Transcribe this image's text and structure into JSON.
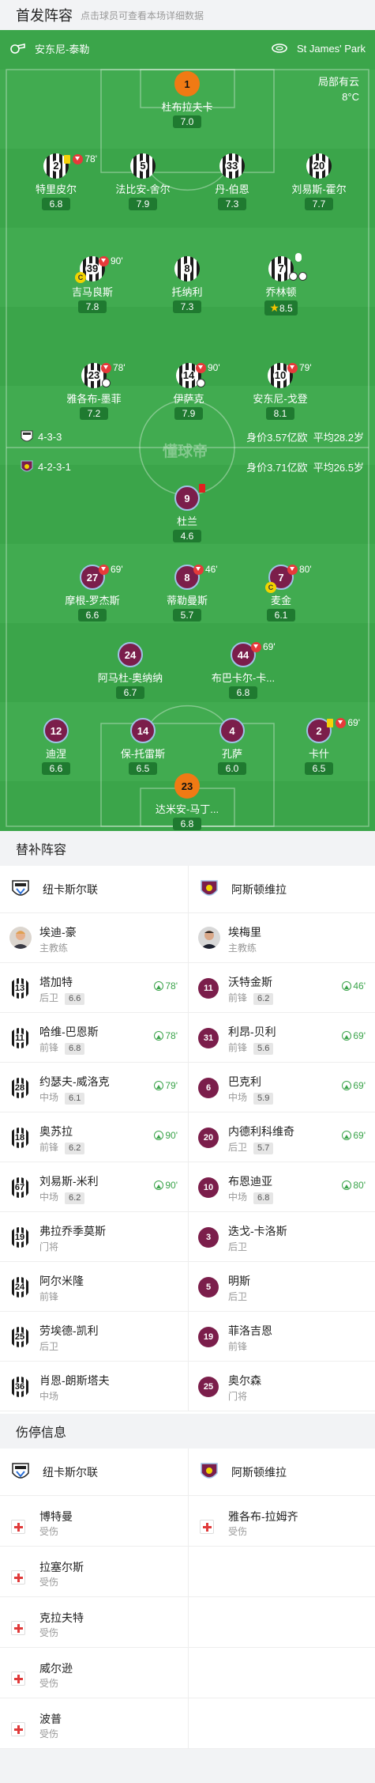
{
  "header": {
    "title": "首发阵容",
    "subtitle": "点击球员可查看本场详细数据"
  },
  "venue": {
    "ref_name": "安东尼-泰勒",
    "stadium": "St James' Park"
  },
  "weather": {
    "condition": "局部有云",
    "temp": "8°C"
  },
  "home": {
    "formation": "4-3-3",
    "value": "身价3.57亿欧",
    "age": "平均28.2岁",
    "gk": {
      "num": "1",
      "name": "杜布拉夫卡",
      "rating": "7.0"
    },
    "def": [
      {
        "num": "2",
        "name": "特里皮尔",
        "rating": "6.8",
        "sub": "78'"
      },
      {
        "num": "5",
        "name": "法比安-舍尔",
        "rating": "7.9"
      },
      {
        "num": "33",
        "name": "丹-伯恩",
        "rating": "7.3"
      },
      {
        "num": "20",
        "name": "刘易斯-霍尔",
        "rating": "7.7"
      }
    ],
    "mid": [
      {
        "num": "39",
        "name": "吉马良斯",
        "rating": "7.8",
        "sub": "90'"
      },
      {
        "num": "8",
        "name": "托纳利",
        "rating": "7.3"
      },
      {
        "num": "7",
        "name": "乔林顿",
        "rating": "8.5"
      }
    ],
    "fwd": [
      {
        "num": "23",
        "name": "雅各布-墨菲",
        "rating": "7.2",
        "sub": "78'"
      },
      {
        "num": "14",
        "name": "伊萨克",
        "rating": "7.9",
        "sub": "90'"
      },
      {
        "num": "10",
        "name": "安东尼-戈登",
        "rating": "8.1",
        "sub": "79'"
      }
    ]
  },
  "away": {
    "formation": "4-2-3-1",
    "value": "身价3.71亿欧",
    "age": "平均26.5岁",
    "st": {
      "num": "9",
      "name": "杜兰",
      "rating": "4.6"
    },
    "am": [
      {
        "num": "27",
        "name": "摩根-罗杰斯",
        "rating": "6.6",
        "sub": "69'"
      },
      {
        "num": "8",
        "name": "蒂勒曼斯",
        "rating": "5.7",
        "sub": "46'"
      },
      {
        "num": "7",
        "name": "麦金",
        "rating": "6.1",
        "sub": "80'"
      }
    ],
    "dm": [
      {
        "num": "24",
        "name": "阿马杜-奥纳纳",
        "rating": "6.7"
      },
      {
        "num": "44",
        "name": "布巴卡尔-卡...",
        "rating": "6.8",
        "sub": "69'"
      }
    ],
    "def": [
      {
        "num": "12",
        "name": "迪涅",
        "rating": "6.6"
      },
      {
        "num": "14",
        "name": "保-托雷斯",
        "rating": "6.5"
      },
      {
        "num": "4",
        "name": "孔萨",
        "rating": "6.0"
      },
      {
        "num": "2",
        "name": "卡什",
        "rating": "6.5",
        "sub": "69'"
      }
    ],
    "gk": {
      "num": "23",
      "name": "达米安-马丁...",
      "rating": "6.8"
    }
  },
  "subs": {
    "title": "替补阵容",
    "home_team": "纽卡斯尔联",
    "away_team": "阿斯顿维拉",
    "coach": [
      {
        "name": "埃迪-豪",
        "role": "主教练"
      },
      {
        "name": "埃梅里",
        "role": "主教练"
      }
    ],
    "rows": [
      [
        {
          "num": "13",
          "name": "塔加特",
          "pos": "后卫",
          "rating": "6.6",
          "in": "78'"
        },
        {
          "num": "11",
          "name": "沃特金斯",
          "pos": "前锋",
          "rating": "6.2",
          "in": "46'"
        }
      ],
      [
        {
          "num": "11",
          "name": "哈维-巴恩斯",
          "pos": "前锋",
          "rating": "6.8",
          "in": "78'"
        },
        {
          "num": "31",
          "name": "利昂-贝利",
          "pos": "前锋",
          "rating": "5.6",
          "in": "69'"
        }
      ],
      [
        {
          "num": "28",
          "name": "约瑟夫-威洛克",
          "pos": "中场",
          "rating": "6.1",
          "in": "79'"
        },
        {
          "num": "6",
          "name": "巴克利",
          "pos": "中场",
          "rating": "5.9",
          "in": "69'"
        }
      ],
      [
        {
          "num": "18",
          "name": "奥苏拉",
          "pos": "前锋",
          "rating": "6.2",
          "in": "90'"
        },
        {
          "num": "20",
          "name": "内德利科维奇",
          "pos": "后卫",
          "rating": "5.7",
          "in": "69'"
        }
      ],
      [
        {
          "num": "67",
          "name": "刘易斯-米利",
          "pos": "中场",
          "rating": "6.2",
          "in": "90'"
        },
        {
          "num": "10",
          "name": "布恩迪亚",
          "pos": "中场",
          "rating": "6.8",
          "in": "80'"
        }
      ],
      [
        {
          "num": "19",
          "name": "弗拉乔季莫斯",
          "pos": "门将"
        },
        {
          "num": "3",
          "name": "迭戈-卡洛斯",
          "pos": "后卫"
        }
      ],
      [
        {
          "num": "24",
          "name": "阿尔米隆",
          "pos": "前锋"
        },
        {
          "num": "5",
          "name": "明斯",
          "pos": "后卫"
        }
      ],
      [
        {
          "num": "25",
          "name": "劳埃德-凯利",
          "pos": "后卫"
        },
        {
          "num": "19",
          "name": "菲洛吉恩",
          "pos": "前锋"
        }
      ],
      [
        {
          "num": "36",
          "name": "肖恩-朗斯塔夫",
          "pos": "中场"
        },
        {
          "num": "25",
          "name": "奥尔森",
          "pos": "门将"
        }
      ]
    ]
  },
  "injuries": {
    "title": "伤停信息",
    "home_team": "纽卡斯尔联",
    "away_team": "阿斯顿维拉",
    "home": [
      {
        "name": "博特曼",
        "status": "受伤"
      },
      {
        "name": "拉塞尔斯",
        "status": "受伤"
      },
      {
        "name": "克拉夫特",
        "status": "受伤"
      },
      {
        "name": "威尔逊",
        "status": "受伤"
      },
      {
        "name": "波普",
        "status": "受伤"
      }
    ],
    "away": [
      {
        "name": "雅各布-拉姆齐",
        "status": "受伤"
      }
    ]
  },
  "watermark": "懂球帝",
  "colors": {
    "pitch": "#3ba54a",
    "villa": "#7b1e4b",
    "accent_green": "#3aa34a"
  }
}
